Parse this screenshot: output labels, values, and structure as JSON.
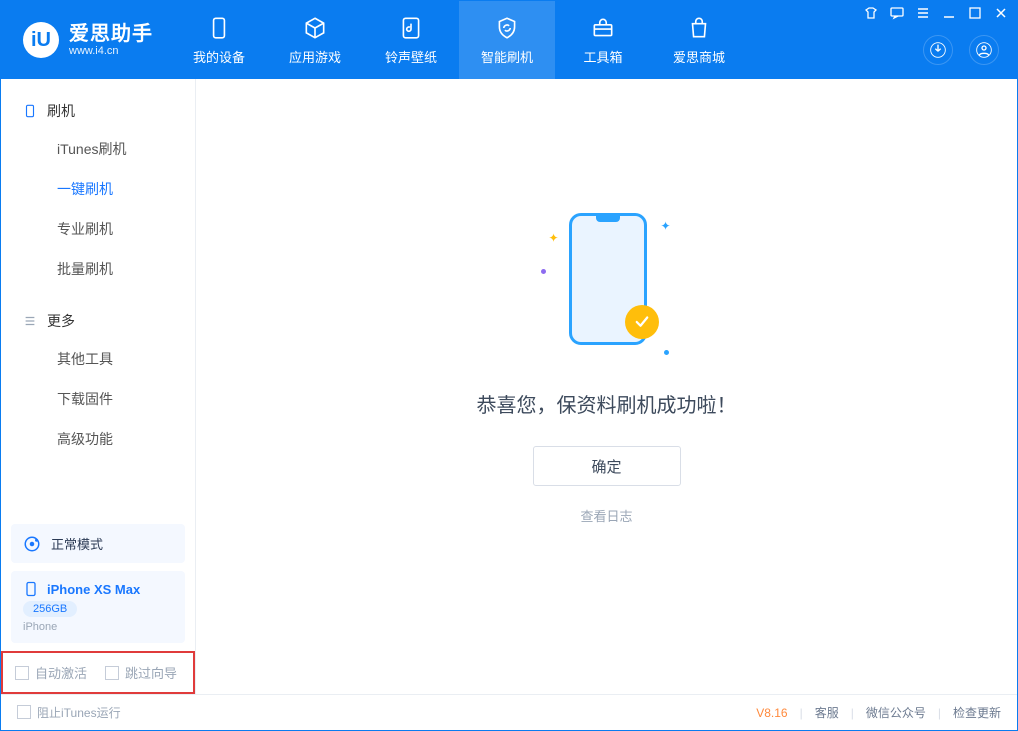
{
  "app": {
    "name": "爱思助手",
    "subtitle": "www.i4.cn"
  },
  "nav": {
    "items": [
      {
        "label": "我的设备"
      },
      {
        "label": "应用游戏"
      },
      {
        "label": "铃声壁纸"
      },
      {
        "label": "智能刷机"
      },
      {
        "label": "工具箱"
      },
      {
        "label": "爱思商城"
      }
    ]
  },
  "sidebar": {
    "section1_title": "刷机",
    "section1_items": [
      "iTunes刷机",
      "一键刷机",
      "专业刷机",
      "批量刷机"
    ],
    "active_item": "一键刷机",
    "section2_title": "更多",
    "section2_items": [
      "其他工具",
      "下载固件",
      "高级功能"
    ]
  },
  "mode_card": {
    "label": "正常模式"
  },
  "device_card": {
    "name": "iPhone XS Max",
    "capacity": "256GB",
    "type": "iPhone"
  },
  "checks": {
    "auto_activate": "自动激活",
    "skip_guide": "跳过向导"
  },
  "main": {
    "success_text": "恭喜您，保资料刷机成功啦！",
    "ok_label": "确定",
    "log_link": "查看日志"
  },
  "bottom": {
    "block_itunes": "阻止iTunes运行",
    "version": "V8.16",
    "links": [
      "客服",
      "微信公众号",
      "检查更新"
    ]
  }
}
